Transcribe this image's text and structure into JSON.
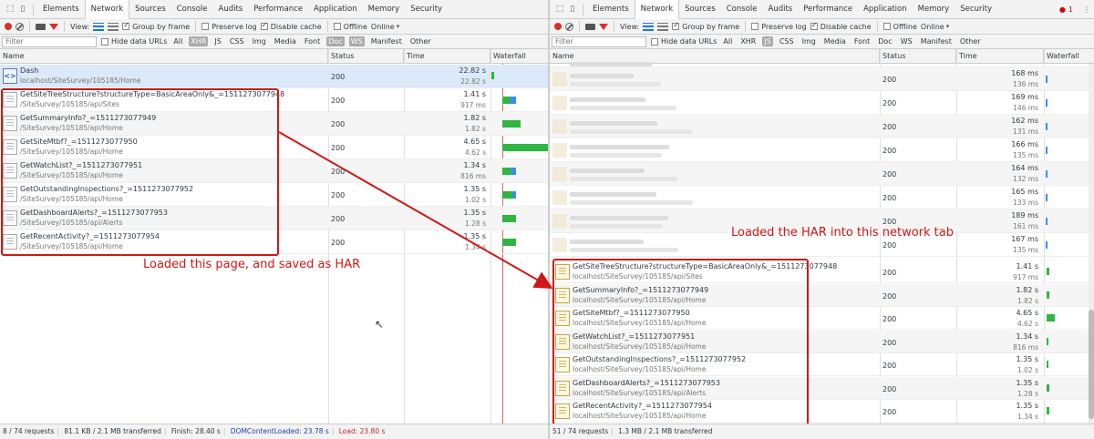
{
  "devtools_tabs": [
    "Elements",
    "Network",
    "Sources",
    "Console",
    "Audits",
    "Performance",
    "Application",
    "Memory",
    "Security"
  ],
  "active_tab": "Network",
  "toolbar": {
    "view_label": "View:",
    "group_by_frame": "Group by frame",
    "preserve_log": "Preserve log",
    "disable_cache": "Disable cache",
    "offline": "Offline",
    "throttle": "Online"
  },
  "filter": {
    "placeholder": "Filter",
    "hide_data_urls": "Hide data URLs",
    "types": [
      "All",
      "XHR",
      "JS",
      "CSS",
      "Img",
      "Media",
      "Font",
      "Doc",
      "WS",
      "Manifest",
      "Other"
    ]
  },
  "columns": {
    "name": "Name",
    "status": "Status",
    "time": "Time",
    "waterfall": "Waterfall"
  },
  "left_pane": {
    "selected_types": [
      "XHR",
      "Doc",
      "WS"
    ],
    "rows": [
      {
        "name": "Dash",
        "path": "localhost/SiteSurvey/105185/Home",
        "status": "200",
        "time": "22.82 s",
        "latency": "22.82 s",
        "icon": "html-icon"
      },
      {
        "name": "GetSiteTreeStructure?structureType=BasicAreaOnly&_=1511273077948",
        "path": "/SiteSurvey/105185/api/Sites",
        "status": "200",
        "time": "1.41 s",
        "latency": "917 ms",
        "icon": "document-icon"
      },
      {
        "name": "GetSummaryInfo?_=1511273077949",
        "path": "/SiteSurvey/105185/api/Home",
        "status": "200",
        "time": "1.82 s",
        "latency": "1.82 s",
        "icon": "document-icon"
      },
      {
        "name": "GetSiteMtbf?_=1511273077950",
        "path": "/SiteSurvey/105185/api/Home",
        "status": "200",
        "time": "4.65 s",
        "latency": "4.62 s",
        "icon": "document-icon"
      },
      {
        "name": "GetWatchList?_=1511273077951",
        "path": "/SiteSurvey/105185/api/Home",
        "status": "200",
        "time": "1.34 s",
        "latency": "816 ms",
        "icon": "document-icon"
      },
      {
        "name": "GetOutstandingInspections?_=1511273077952",
        "path": "/SiteSurvey/105185/api/Home",
        "status": "200",
        "time": "1.35 s",
        "latency": "1.02 s",
        "icon": "document-icon"
      },
      {
        "name": "GetDashboardAlerts?_=1511273077953",
        "path": "/SiteSurvey/105185/api/Alerts",
        "status": "200",
        "time": "1.35 s",
        "latency": "1.28 s",
        "icon": "document-icon"
      },
      {
        "name": "GetRecentActivity?_=1511273077954",
        "path": "/SiteSurvey/105185/api/Home",
        "status": "200",
        "time": "1.35 s",
        "latency": "1.34 s",
        "icon": "document-icon"
      }
    ],
    "status_bar": {
      "requests": "8 / 74 requests",
      "transferred": "81.1 KB / 2.1 MB transferred",
      "finish": "Finish: 28.40 s",
      "dom_content_loaded": "DOMContentLoaded: 23.78 s",
      "load": "Load: 23.80 s"
    }
  },
  "right_pane": {
    "selected_types": [
      "JS"
    ],
    "error_count": "1",
    "top_path": "localhost/SiteSurvey/...",
    "blurred_rows": [
      {
        "status": "200",
        "time": "168 ms",
        "latency": "136 ms"
      },
      {
        "status": "200",
        "time": "169 ms",
        "latency": "146 ms"
      },
      {
        "status": "200",
        "time": "162 ms",
        "latency": "131 ms"
      },
      {
        "status": "200",
        "time": "166 ms",
        "latency": "135 ms"
      },
      {
        "status": "200",
        "time": "164 ms",
        "latency": "132 ms"
      },
      {
        "status": "200",
        "time": "165 ms",
        "latency": "133 ms"
      },
      {
        "status": "200",
        "time": "189 ms",
        "latency": "161 ms"
      },
      {
        "status": "200",
        "time": "167 ms",
        "latency": "135 ms"
      }
    ],
    "rows": [
      {
        "name": "GetSiteTreeStructure?structureType=BasicAreaOnly&_=1511273077948",
        "path": "localhost/SiteSurvey/105185/api/Sites",
        "status": "200",
        "time": "1.41 s",
        "latency": "917 ms"
      },
      {
        "name": "GetSummaryInfo?_=1511273077949",
        "path": "localhost/SiteSurvey/105185/api/Home",
        "status": "200",
        "time": "1.82 s",
        "latency": "1.82 s"
      },
      {
        "name": "GetSiteMtbf?_=1511273077950",
        "path": "localhost/SiteSurvey/105185/api/Home",
        "status": "200",
        "time": "4.65 s",
        "latency": "4.62 s"
      },
      {
        "name": "GetWatchList?_=1511273077951",
        "path": "localhost/SiteSurvey/105185/api/Home",
        "status": "200",
        "time": "1.34 s",
        "latency": "816 ms"
      },
      {
        "name": "GetOutstandingInspections?_=1511273077952",
        "path": "localhost/SiteSurvey/105185/api/Home",
        "status": "200",
        "time": "1.35 s",
        "latency": "1.02 s"
      },
      {
        "name": "GetDashboardAlerts?_=1511273077953",
        "path": "localhost/SiteSurvey/105185/api/Alerts",
        "status": "200",
        "time": "1.35 s",
        "latency": "1.28 s"
      },
      {
        "name": "GetRecentActivity?_=1511273077954",
        "path": "localhost/SiteSurvey/105185/api/Home",
        "status": "200",
        "time": "1.35 s",
        "latency": "1.34 s"
      }
    ],
    "status_bar": {
      "requests": "51 / 74 requests",
      "transferred": "1.3 MB / 2.1 MB transferred"
    }
  },
  "annotations": {
    "left": "Loaded this page, and saved as HAR",
    "right": "Loaded the HAR into this network tab"
  },
  "colors": {
    "annotation": "#d01818",
    "bar_green": "#2fb542",
    "bar_blue": "#3c8ee6",
    "selected_row": "#dbe9f8"
  }
}
